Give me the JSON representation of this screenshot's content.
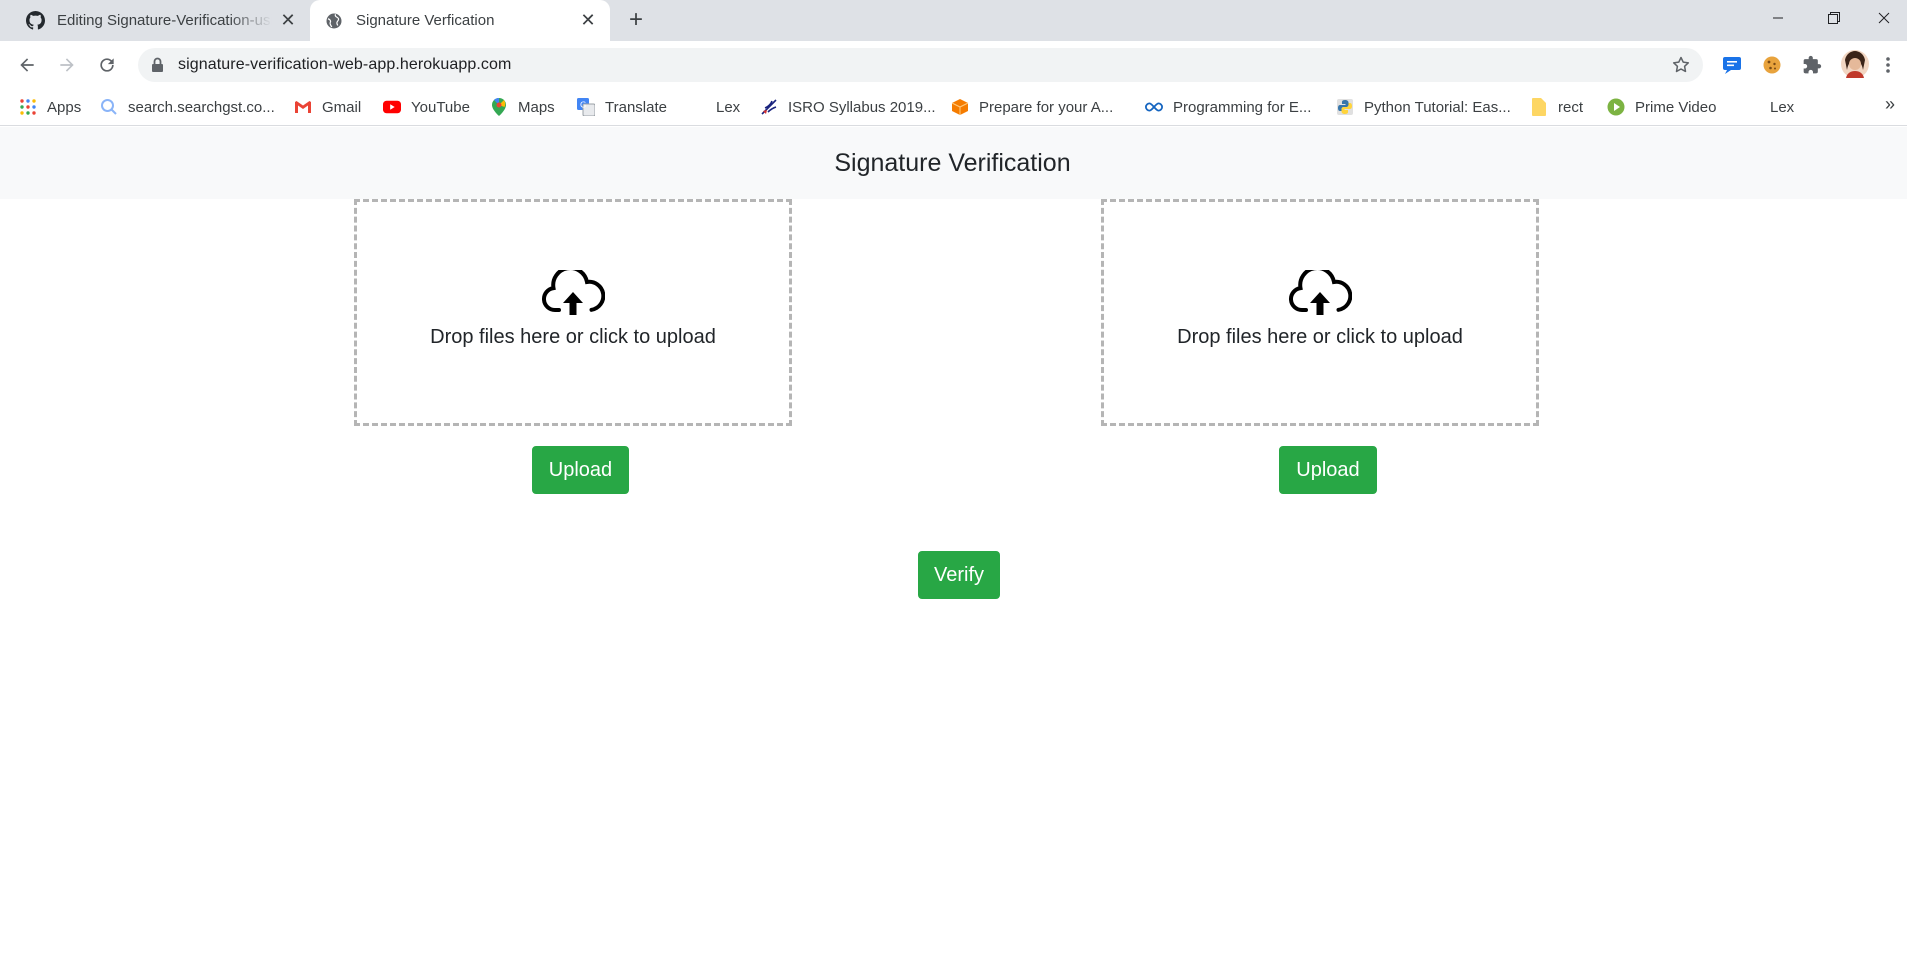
{
  "browser": {
    "tabs": [
      {
        "title": "Editing Signature-Verification-using-",
        "favicon": "github-icon",
        "active": false
      },
      {
        "title": "Signature Verfication",
        "favicon": "globe-icon",
        "active": true
      }
    ],
    "new_tab_symbol": "+",
    "close_symbol": "✕",
    "address_bar": {
      "url": "signature-verification-web-app.herokuapp.com"
    },
    "bookmarks": [
      {
        "label": "Apps",
        "icon": "apps-grid-icon"
      },
      {
        "label": "search.searchgst.co...",
        "icon": "search-icon"
      },
      {
        "label": "Gmail",
        "icon": "gmail-icon"
      },
      {
        "label": "YouTube",
        "icon": "youtube-icon"
      },
      {
        "label": "Maps",
        "icon": "maps-icon"
      },
      {
        "label": "Translate",
        "icon": "translate-icon"
      },
      {
        "label": "Lex",
        "icon": "blank-icon"
      },
      {
        "label": "ISRO Syllabus 2019...",
        "icon": "isro-icon"
      },
      {
        "label": "Prepare for your A...",
        "icon": "box-icon"
      },
      {
        "label": "Programming for E...",
        "icon": "infinity-icon"
      },
      {
        "label": "Python Tutorial: Eas...",
        "icon": "python-icon"
      },
      {
        "label": "rect",
        "icon": "note-icon"
      },
      {
        "label": "Prime Video",
        "icon": "play-icon"
      },
      {
        "label": "Lex",
        "icon": "blank-icon"
      }
    ],
    "more_bookmarks_symbol": "»"
  },
  "page": {
    "navbar_title": "Signature Verification",
    "dropzones": [
      {
        "message": "Drop files here or click to upload",
        "button_label": "Upload"
      },
      {
        "message": "Drop files here or click to upload",
        "button_label": "Upload"
      }
    ],
    "verify_label": "Verify"
  },
  "colors": {
    "success": "#28a745",
    "navbar_bg": "#f8f9fa",
    "dropzone_border": "#b5b5b5",
    "tabstrip_bg": "#dee1e6"
  }
}
